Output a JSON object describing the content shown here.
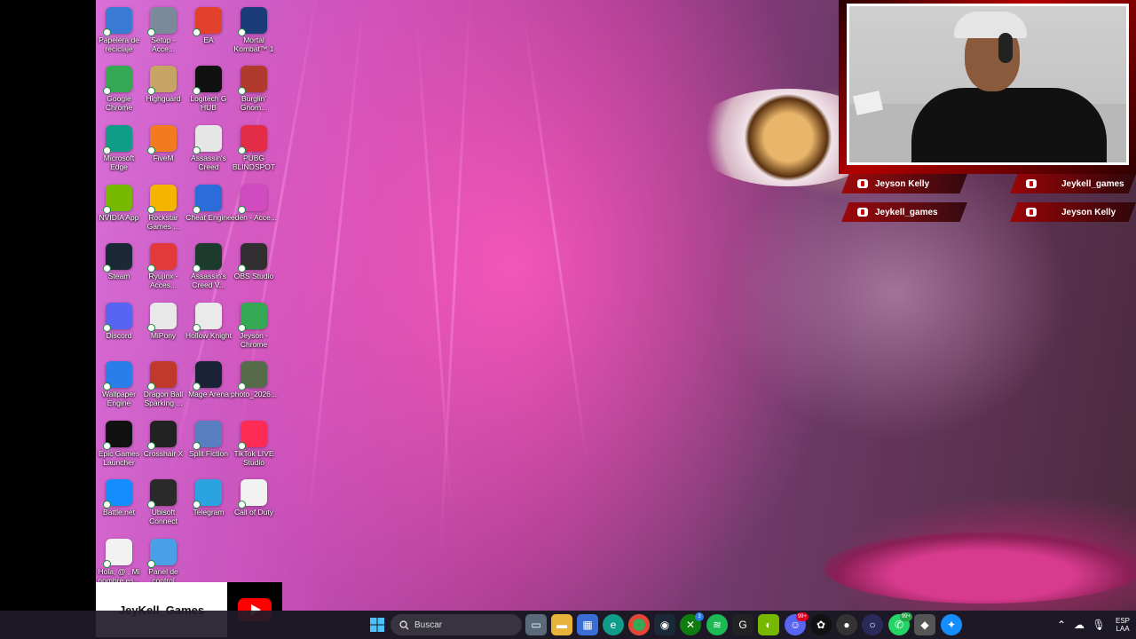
{
  "desktop": {
    "icons": [
      {
        "label": "Papelera de reciclaje",
        "icon": "recycle-bin-icon",
        "color": "#3a7bd5"
      },
      {
        "label": "Setup - Acce...",
        "icon": "setup-icon",
        "color": "#7a8a9a"
      },
      {
        "label": "EA",
        "icon": "ea-icon",
        "color": "#e2422b"
      },
      {
        "label": "Mortal Kombat™ 1",
        "icon": "mortal-kombat-icon",
        "color": "#1a3d7a"
      },
      {
        "label": "Google Chrome",
        "icon": "chrome-icon",
        "color": "#34a853"
      },
      {
        "label": "Highguard",
        "icon": "highguard-icon",
        "color": "#c8a464"
      },
      {
        "label": "Logitech G HUB",
        "icon": "logitech-icon",
        "color": "#111111"
      },
      {
        "label": "Burglin' Gnom...",
        "icon": "burglin-gnomes-icon",
        "color": "#b03a2e"
      },
      {
        "label": "Microsoft Edge",
        "icon": "edge-icon",
        "color": "#0f9d8a"
      },
      {
        "label": "FiveM",
        "icon": "fivem-icon",
        "color": "#f47a20"
      },
      {
        "label": "Assassin's Creed",
        "icon": "assassins-creed-icon",
        "color": "#e6e6e6"
      },
      {
        "label": "PUBG BLINDSPOT",
        "icon": "pubg-icon",
        "color": "#e32d48"
      },
      {
        "label": "NVIDIA App",
        "icon": "nvidia-icon",
        "color": "#76b900"
      },
      {
        "label": "Rockstar Games ...",
        "icon": "rockstar-icon",
        "color": "#f4b400"
      },
      {
        "label": "Cheat Engine",
        "icon": "cheat-engine-icon",
        "color": "#2a6dd8"
      },
      {
        "label": "eden - Acce...",
        "icon": "eden-icon",
        "color": "#d04ac0"
      },
      {
        "label": "Steam",
        "icon": "steam-icon",
        "color": "#1b2838"
      },
      {
        "label": "Ryujinx - Acces...",
        "icon": "ryujinx-icon",
        "color": "#e23a3a"
      },
      {
        "label": "Assassin's Creed V...",
        "icon": "assassins-creed-valhalla-icon",
        "color": "#1d3a2e"
      },
      {
        "label": "OBS Studio",
        "icon": "obs-icon",
        "color": "#302e31"
      },
      {
        "label": "Discord",
        "icon": "discord-icon",
        "color": "#5865f2"
      },
      {
        "label": "MiPony",
        "icon": "mipony-icon",
        "color": "#e8e8e8"
      },
      {
        "label": "Hollow Knight",
        "icon": "hollow-knight-icon",
        "color": "#eaeaea"
      },
      {
        "label": "Jeyson - Chrome",
        "icon": "chrome-profile-icon",
        "color": "#34a853"
      },
      {
        "label": "Wallpaper Engine",
        "icon": "wallpaper-engine-icon",
        "color": "#2b7de9"
      },
      {
        "label": "Dragon Ball Sparking ...",
        "icon": "dragon-ball-icon",
        "color": "#c0392b"
      },
      {
        "label": "Mage Arena",
        "icon": "mage-arena-icon",
        "color": "#1a2238"
      },
      {
        "label": "photo_2026...",
        "icon": "photo-icon",
        "color": "#556b4a"
      },
      {
        "label": "Epic Games Launcher",
        "icon": "epic-games-icon",
        "color": "#111111"
      },
      {
        "label": "Crosshair X",
        "icon": "crosshair-icon",
        "color": "#222222"
      },
      {
        "label": "Split Fiction",
        "icon": "split-fiction-icon",
        "color": "#5a7fc0"
      },
      {
        "label": "TikTok LIVE Studio",
        "icon": "tiktok-icon",
        "color": "#fe2c55"
      },
      {
        "label": "Battle.net",
        "icon": "battlenet-icon",
        "color": "#148eff"
      },
      {
        "label": "Ubisoft Connect",
        "icon": "ubisoft-icon",
        "color": "#2a2a2a"
      },
      {
        "label": "Telegram",
        "icon": "telegram-icon",
        "color": "#2aa3e0"
      },
      {
        "label": "Call of Duty",
        "icon": "file-icon",
        "color": "#f2f2f2"
      },
      {
        "label": "Hola, @ , Mi nombre es...",
        "icon": "document-icon",
        "color": "#f2f2f2"
      },
      {
        "label": "Panel de control",
        "icon": "control-panel-icon",
        "color": "#4aa0e6"
      }
    ]
  },
  "overlay": {
    "socials": [
      {
        "text": "Jeyson Kelly",
        "icon": "instagram-icon"
      },
      {
        "text": "Jeykell_games",
        "icon": "youtube-icon"
      },
      {
        "text": "Jeykell_games",
        "icon": "youtube-icon"
      },
      {
        "text": "Jeyson Kelly",
        "icon": "facebook-icon"
      }
    ],
    "channel_name": "JeyKell_Games"
  },
  "taskbar": {
    "search_placeholder": "Buscar",
    "language": "ESP",
    "region": "LAA",
    "badges": {
      "xbox": "3",
      "whatsapp": "99+",
      "discord": "99+"
    }
  }
}
